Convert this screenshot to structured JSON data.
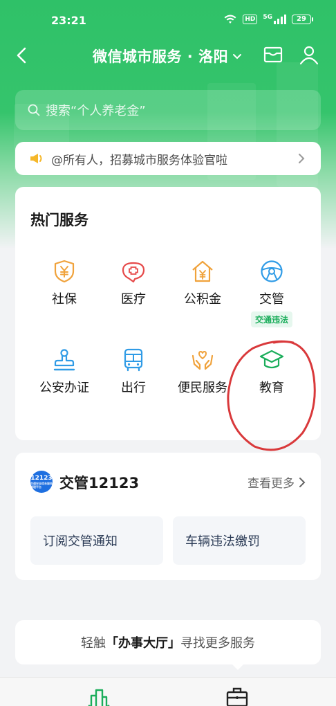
{
  "status_bar": {
    "time": "23:21",
    "network": "5G",
    "hd": "HD",
    "battery": "29"
  },
  "nav": {
    "title": "微信城市服务 · 洛阳"
  },
  "search": {
    "placeholder": "搜索“个人养老金”"
  },
  "notice": {
    "text": "@所有人，招募城市服务体验官啦"
  },
  "hot_services": {
    "title": "热门服务",
    "items": [
      {
        "label": "社保",
        "icon": "shield-yen-icon",
        "color": "#f0a23b"
      },
      {
        "label": "医疗",
        "icon": "medical-cross-icon",
        "color": "#e64a4a"
      },
      {
        "label": "公积金",
        "icon": "house-yen-icon",
        "color": "#f0a23b"
      },
      {
        "label": "交管",
        "icon": "steering-wheel-icon",
        "color": "#2f9be6",
        "badge": "交通违法"
      },
      {
        "label": "公安办证",
        "icon": "stamp-icon",
        "color": "#2f9be6"
      },
      {
        "label": "出行",
        "icon": "bus-icon",
        "color": "#2f9be6"
      },
      {
        "label": "便民服务",
        "icon": "helping-hands-icon",
        "color": "#f0a23b"
      },
      {
        "label": "教育",
        "icon": "graduation-cap-icon",
        "color": "#1aad5a"
      }
    ]
  },
  "traffic": {
    "logo_text": "12123",
    "logo_subtext": "交通安全综合服务管理平台",
    "title": "交管12123",
    "more": "查看更多",
    "tiles": [
      "订阅交管通知",
      "车辆违法缴罚"
    ]
  },
  "hall": {
    "prefix": "轻触",
    "highlight": "「办事大厅」",
    "suffix": "寻找更多服务"
  },
  "colors": {
    "brand_green": "#2fc168",
    "annotation_red": "#d9393b"
  }
}
